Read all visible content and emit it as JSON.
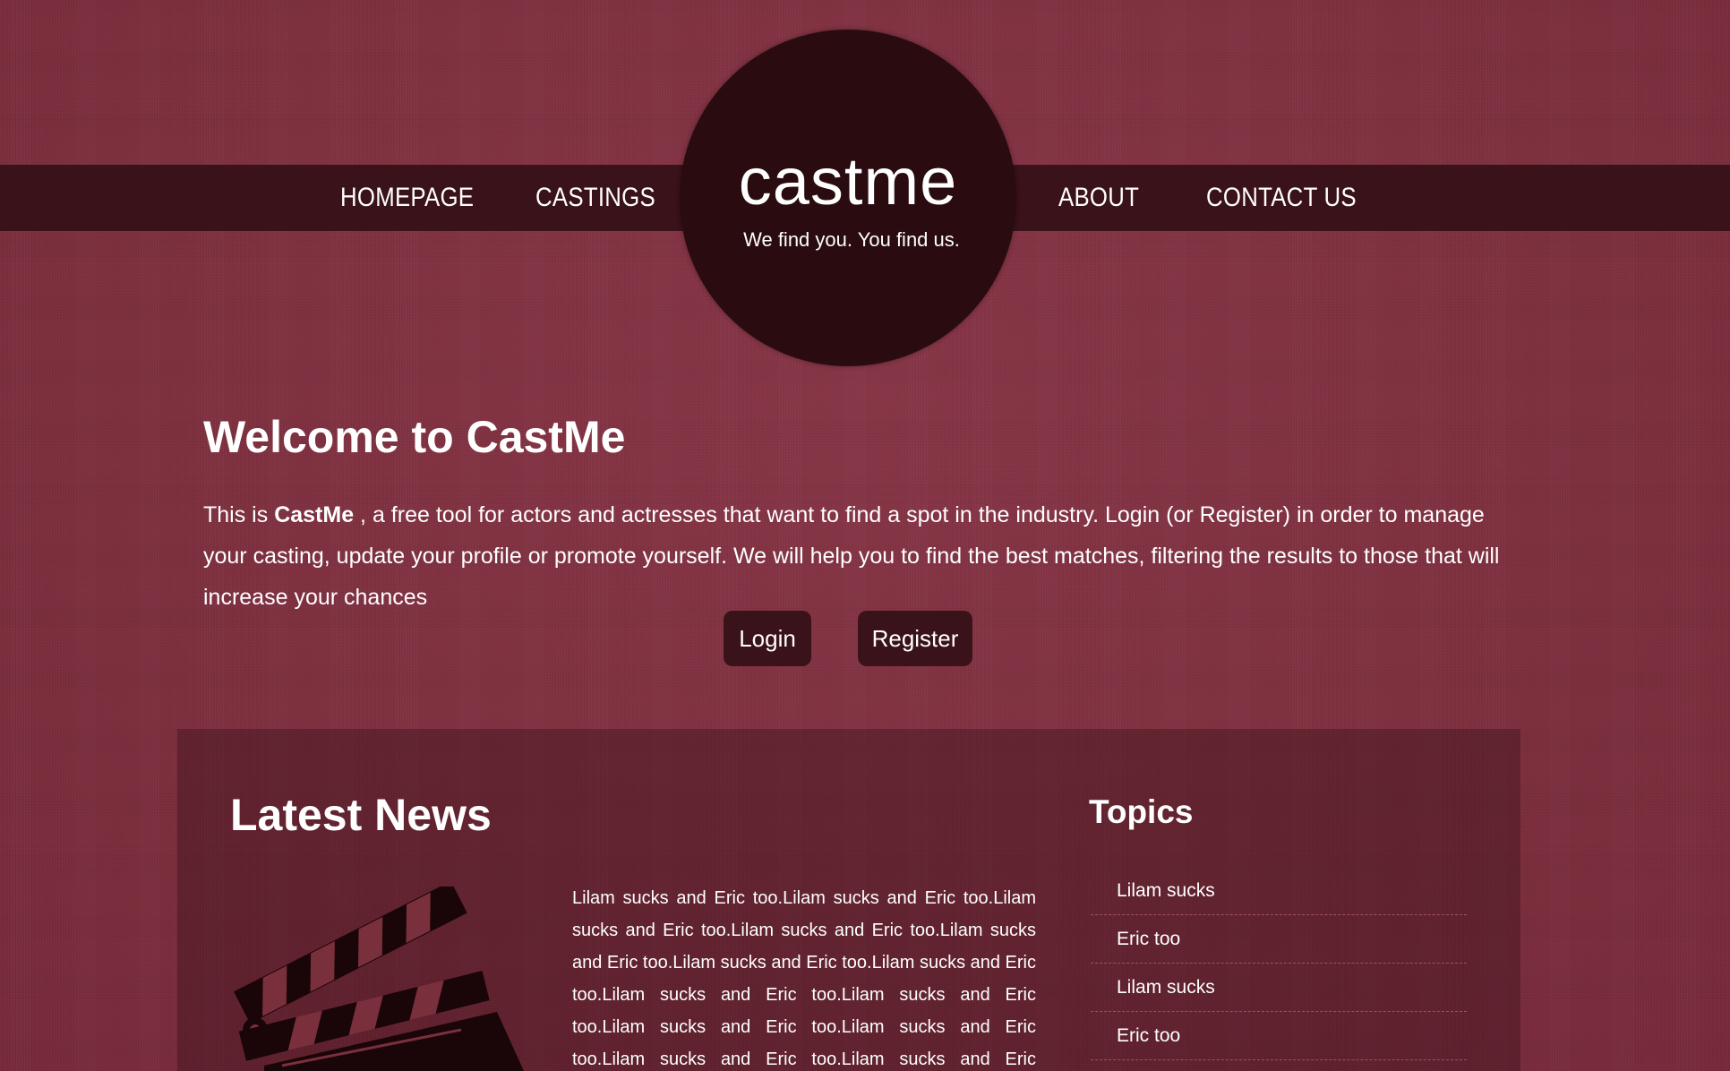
{
  "nav": {
    "left": [
      {
        "label": "HOMEPAGE"
      },
      {
        "label": "CASTINGS"
      }
    ],
    "right": [
      {
        "label": "ABOUT"
      },
      {
        "label": "CONTACT US"
      }
    ]
  },
  "logo": {
    "title": "castme",
    "tagline": "We find you. You find us."
  },
  "welcome": {
    "title": "Welcome to CastMe",
    "intro_prefix": "This is ",
    "intro_brand": "CastMe",
    "intro_rest": " , a free tool for actors and actresses that want to find a spot in the industry. Login (or Register) in order to manage your casting, update your profile or promote yourself. We will help you to find the best matches, filtering the results to those that will increase your chances",
    "login_label": "Login",
    "register_label": "Register"
  },
  "news": {
    "title": "Latest News",
    "image_icon": "clapperboard-icon",
    "body": "Lilam sucks and Eric too.Lilam sucks and Eric too.Lilam sucks and Eric too.Lilam sucks and Eric too.Lilam sucks and Eric too.Lilam sucks and Eric too.Lilam sucks and Eric too.Lilam sucks and Eric too.Lilam sucks and Eric too.Lilam sucks and Eric too.Lilam sucks and Eric too.Lilam sucks and Eric too.Lilam sucks and Eric too.Lilam sucks and Eric too.Lilam sucks and Eric"
  },
  "topics": {
    "title": "Topics",
    "items": [
      {
        "label": "Lilam sucks"
      },
      {
        "label": "Eric too"
      },
      {
        "label": "Lilam sucks"
      },
      {
        "label": "Eric too"
      }
    ]
  },
  "colors": {
    "background": "#7f3140",
    "navbar": "#3a1219",
    "logo_circle": "#2a0c10",
    "button": "#3a1219"
  }
}
